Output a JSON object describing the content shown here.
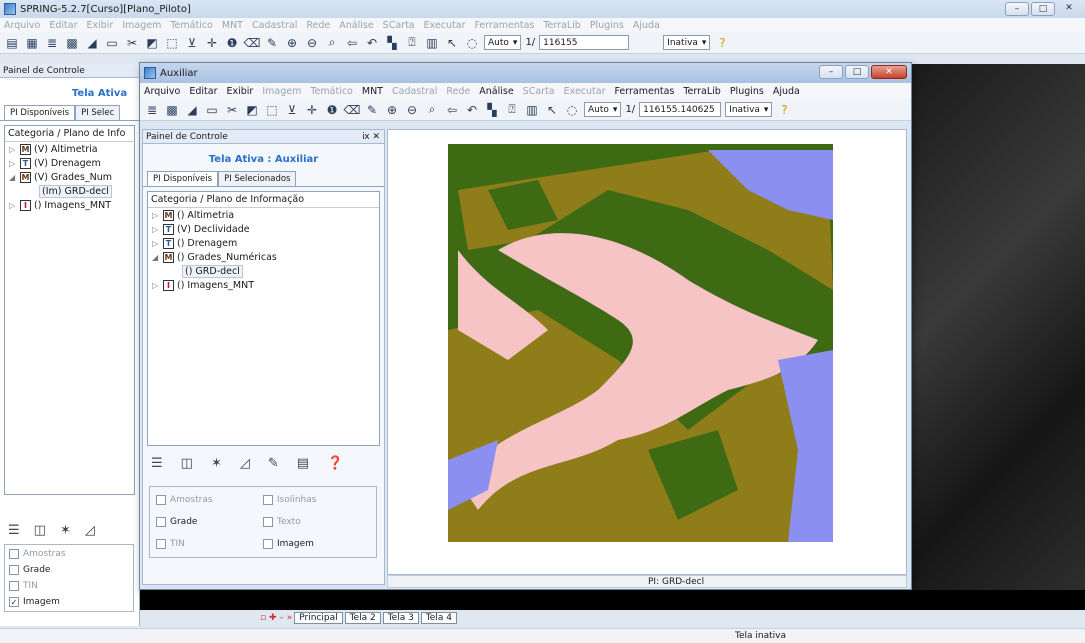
{
  "main": {
    "title": "SPRING-5.2.7[Curso][Plano_Piloto]",
    "menu": [
      "Arquivo",
      "Editar",
      "Exibir",
      "Imagem",
      "Temático",
      "MNT",
      "Cadastral",
      "Rede",
      "Análise",
      "SCarta",
      "Executar",
      "Ferramentas",
      "TerraLib",
      "Plugins",
      "Ajuda"
    ],
    "toolbar": {
      "scale_mode": "Auto",
      "scale_prefix": "1/",
      "scale_value": "116155",
      "status_select": "Inativa"
    },
    "panel": {
      "header": "Painel de Controle",
      "active_screen": "Tela Ativa",
      "tabs": [
        "PI Disponíveis",
        "PI Selec"
      ],
      "tree_header": "Categoria / Plano de Info",
      "items": [
        {
          "icon": "M",
          "label": "(V) Altimetria"
        },
        {
          "icon": "T",
          "label": "(V) Drenagem"
        },
        {
          "icon": "M",
          "label": "(V) Grades_Num"
        },
        {
          "icon": "I",
          "label": "() Imagens_MNT"
        }
      ],
      "sub_item": "(Im) GRD-decl",
      "checks": [
        {
          "label": "Amostras",
          "checked": false,
          "enabled": false
        },
        {
          "label": "Grade",
          "checked": false,
          "enabled": true
        },
        {
          "label": "TIN",
          "checked": false,
          "enabled": false
        },
        {
          "label": "Imagem",
          "checked": true,
          "enabled": true
        }
      ]
    },
    "screen_tabs": [
      "Principal",
      "Tela 2",
      "Tela 3",
      "Tela 4"
    ],
    "status": "Tela inativa"
  },
  "aux": {
    "title": "Auxiliar",
    "menu": [
      "Arquivo",
      "Editar",
      "Exibir",
      "Imagem",
      "Temático",
      "MNT",
      "Cadastral",
      "Rede",
      "Análise",
      "SCarta",
      "Executar",
      "Ferramentas",
      "TerraLib",
      "Plugins",
      "Ajuda"
    ],
    "toolbar": {
      "scale_mode": "Auto",
      "scale_prefix": "1/",
      "scale_value": "116155.140625",
      "status_select": "Inativa"
    },
    "panel": {
      "header": "Painel de Controle",
      "active_screen": "Tela Ativa : Auxiliar",
      "tabs": [
        "PI Disponíveis",
        "PI Selecionados"
      ],
      "tree_header": "Categoria / Plano de Informação",
      "items": [
        {
          "icon": "M",
          "label": "() Altimetria"
        },
        {
          "icon": "T",
          "label": "(V) Declividade"
        },
        {
          "icon": "T",
          "label": "() Drenagem"
        },
        {
          "icon": "M",
          "label": "() Grades_Numéricas"
        },
        {
          "icon": "I",
          "label": "() Imagens_MNT"
        }
      ],
      "sub_item": "() GRD-decl",
      "checks": [
        {
          "label": "Amostras",
          "checked": false,
          "enabled": false
        },
        {
          "label": "Isolinhas",
          "checked": false,
          "enabled": false
        },
        {
          "label": "Grade",
          "checked": false,
          "enabled": true
        },
        {
          "label": "Texto",
          "checked": false,
          "enabled": false
        },
        {
          "label": "TIN",
          "checked": false,
          "enabled": false
        },
        {
          "label": "Imagem",
          "checked": false,
          "enabled": true
        }
      ]
    },
    "status": "PI: GRD-decl"
  },
  "colors": {
    "pink": "#f6c4c4",
    "olive": "#8f7d1a",
    "darkgreen": "#3f6a14",
    "blue": "#8a8ff0"
  }
}
